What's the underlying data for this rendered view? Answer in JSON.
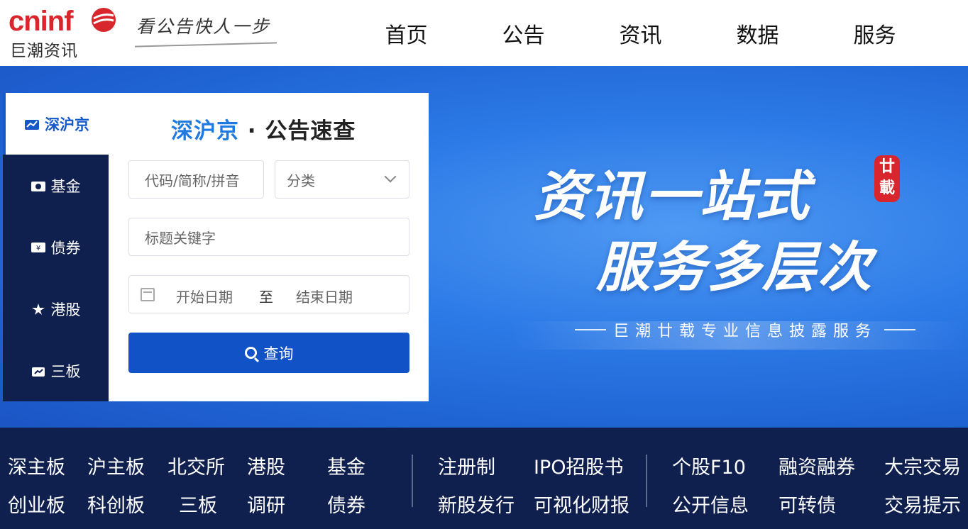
{
  "brand": {
    "logo_word": "cninf",
    "logo_cn": "巨潮资讯",
    "slogan": "看公告快人一步",
    "colors": {
      "logo_red": "#d7262c",
      "accent_blue": "#1558c9",
      "dark_navy": "#0f1f4e"
    }
  },
  "nav": [
    "首页",
    "公告",
    "资讯",
    "数据",
    "服务"
  ],
  "banner": {
    "title_line1": "资讯一站式",
    "title_line2": "服务多层次",
    "seal": [
      "廿",
      "載"
    ],
    "subtitle": "巨潮廿载专业信息披露服务"
  },
  "search": {
    "title_blue": "深沪京",
    "title_sep": "·",
    "title_rest": "公告速查",
    "tabs": [
      {
        "label": "深沪京",
        "icon": "chart-icon",
        "active": true
      },
      {
        "label": "基金",
        "icon": "fund-icon",
        "active": false
      },
      {
        "label": "债券",
        "icon": "bond-icon",
        "active": false
      },
      {
        "label": "港股",
        "icon": "bauhinia-icon",
        "active": false
      },
      {
        "label": "三板",
        "icon": "board-icon",
        "active": false
      }
    ],
    "code_placeholder": "代码/简称/拼音",
    "category_label": "分类",
    "keyword_placeholder": "标题关键字",
    "date_start": "开始日期",
    "date_to": "至",
    "date_end": "结束日期",
    "query_button": "查询"
  },
  "bottom_nav": {
    "group1_row1": [
      "深主板",
      "沪主板",
      "北交所",
      "港股",
      "基金"
    ],
    "group1_row2": [
      "创业板",
      "科创板",
      "三板",
      "调研",
      "债券"
    ],
    "group2_row1": [
      "注册制",
      "IPO招股书"
    ],
    "group2_row2": [
      "新股发行",
      "可视化财报"
    ],
    "group3_row1": [
      "个股F10",
      "融资融券",
      "大宗交易"
    ],
    "group3_row2": [
      "公开信息",
      "可转债",
      "交易提示"
    ]
  }
}
